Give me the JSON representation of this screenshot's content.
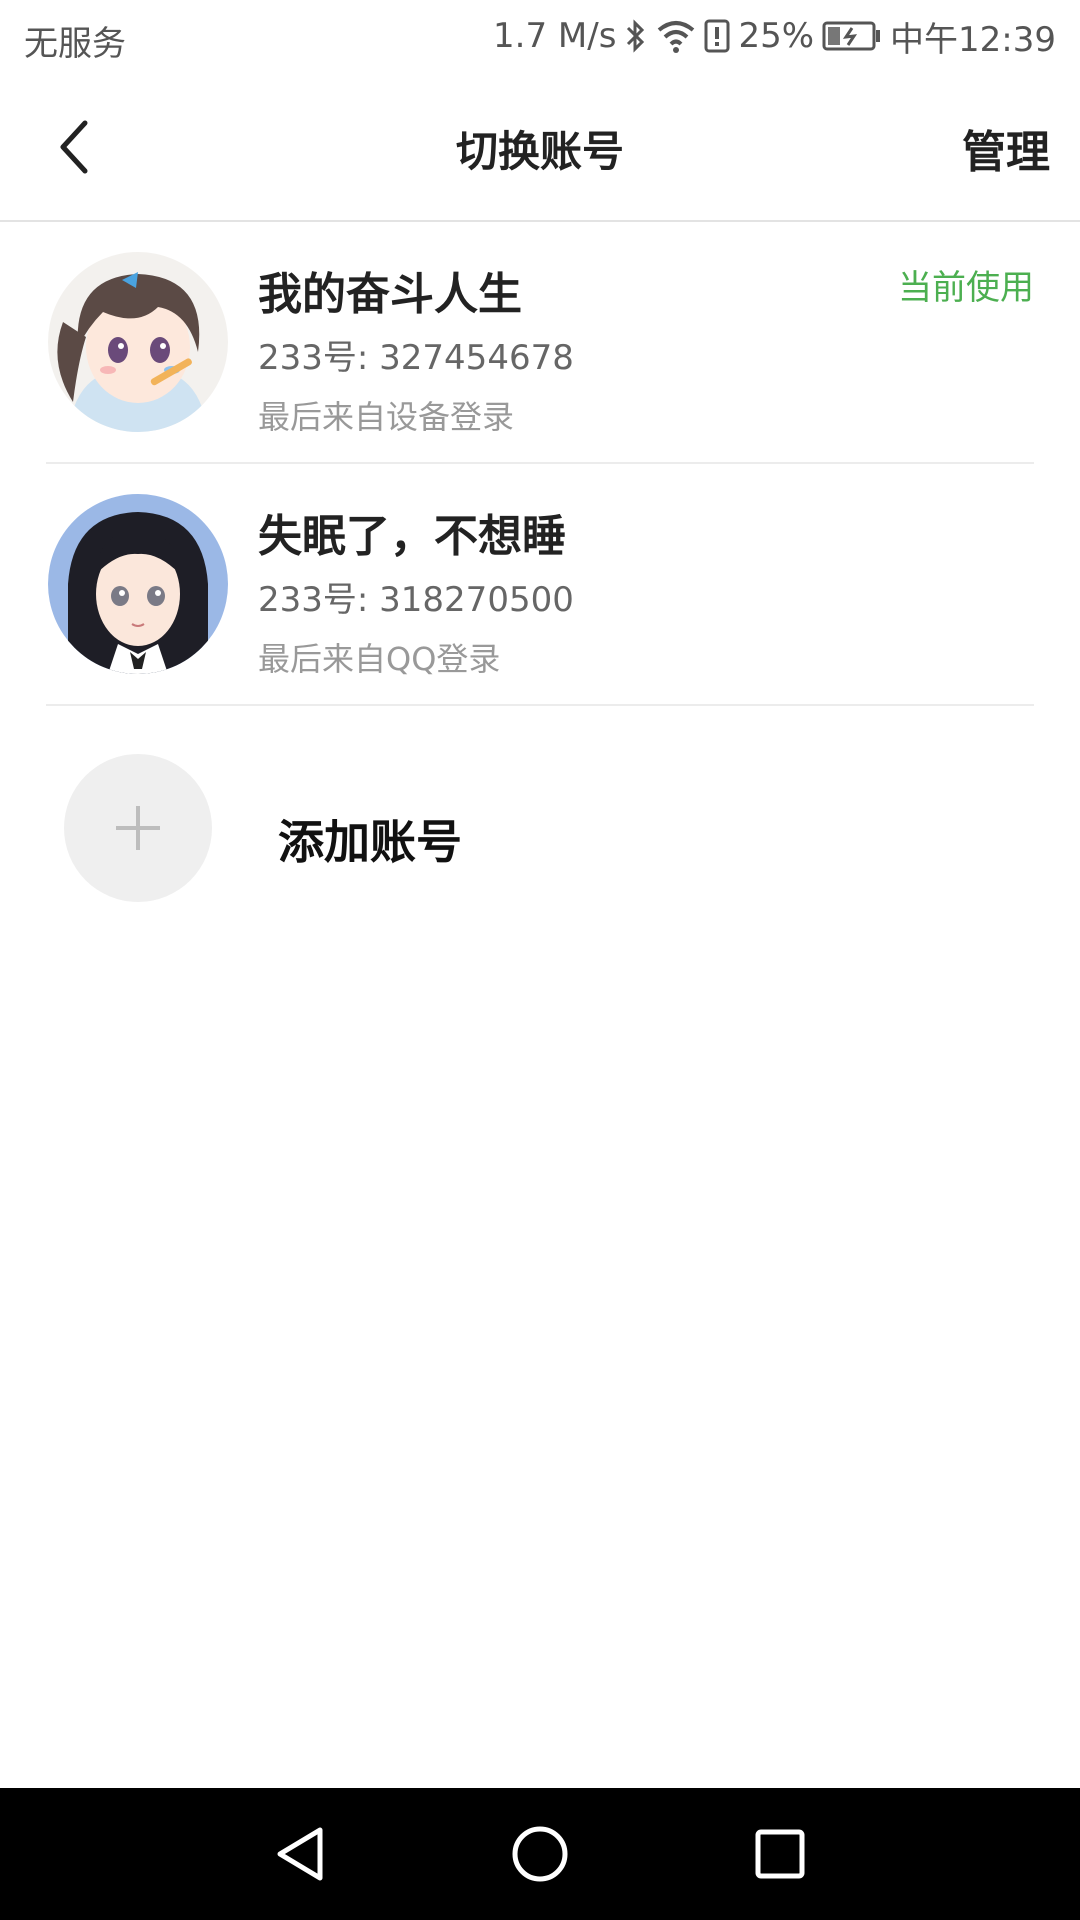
{
  "status_bar": {
    "carrier": "无服务",
    "speed": "1.7 M/s",
    "battery_text": "25%",
    "time": "中午12:39",
    "icons": [
      "bluetooth-icon",
      "wifi-icon",
      "alert-icon",
      "battery-icon"
    ]
  },
  "header": {
    "title": "切换账号",
    "manage_label": "管理",
    "back_icon": "back-chevron-icon"
  },
  "accounts": [
    {
      "name": "我的奋斗人生",
      "id_text": "233号: 327454678",
      "last_login": "最后来自设备登录",
      "badge": "当前使用",
      "avatar": "anime-girl-avatar"
    },
    {
      "name": "失眠了，不想睡",
      "id_text": "233号: 318270500",
      "last_login": "最后来自QQ登录",
      "avatar": "anime-girl-avatar"
    }
  ],
  "add_account": {
    "label": "添加账号",
    "icon": "plus-icon"
  },
  "nav": {
    "icons": [
      "back-triangle-icon",
      "home-circle-icon",
      "recents-square-icon"
    ]
  },
  "colors": {
    "accent_green": "#4caf50",
    "navbar_bg": "#000000"
  }
}
